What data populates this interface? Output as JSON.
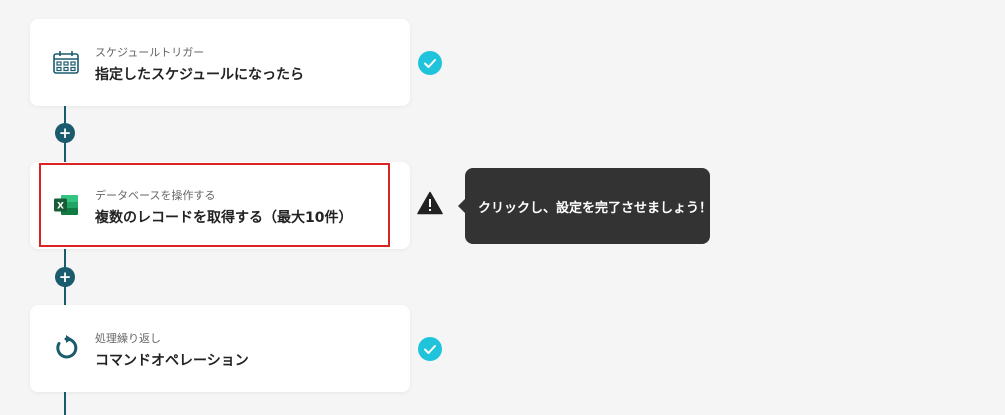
{
  "steps": [
    {
      "subtitle": "スケジュールトリガー",
      "title": "指定したスケジュールになったら",
      "icon": "calendar-schedule-icon",
      "status": "completed"
    },
    {
      "subtitle": "データベースを操作する",
      "title": "複数のレコードを取得する（最大10件）",
      "icon": "excel-icon",
      "status": "warning"
    },
    {
      "subtitle": "処理繰り返し",
      "title": "コマンドオペレーション",
      "icon": "loop-icon",
      "status": "completed"
    }
  ],
  "add_step_symbol": "+",
  "tooltip": {
    "text": "クリックし、設定を完了させましょう！"
  },
  "colors": {
    "connector": "#1b5b6e",
    "check": "#1fc4dc",
    "highlight": "#d92424",
    "tooltip_bg": "#333333",
    "excel_green": "#1d6f42"
  }
}
